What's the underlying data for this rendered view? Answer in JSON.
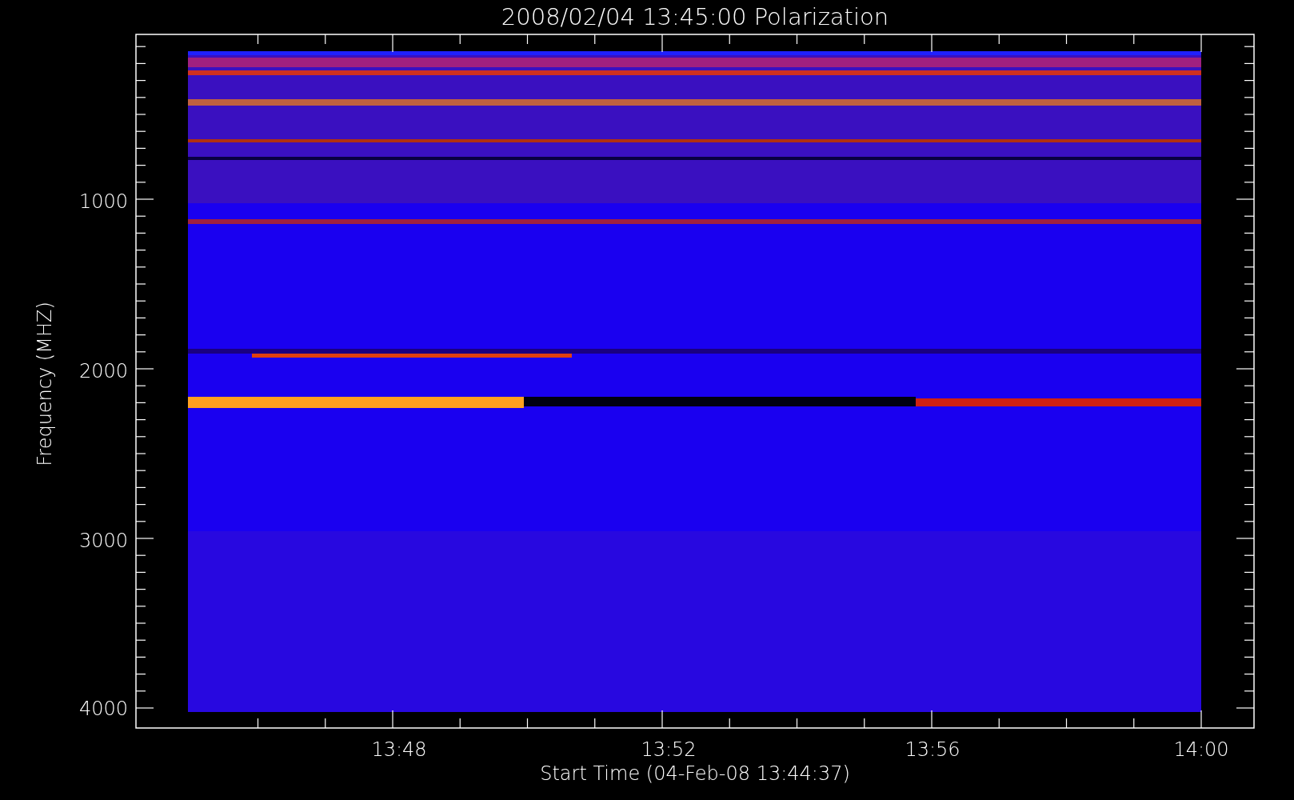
{
  "title": "2008/02/04 13:45:00 Polarization",
  "y_axis": {
    "label": "Frequency (MHZ)",
    "ticks": [
      "1000",
      "2000",
      "3000",
      "4000"
    ]
  },
  "x_axis": {
    "label": "Start Time (04-Feb-08 13:44:37)",
    "ticks": [
      "13:48",
      "13:52",
      "13:56",
      "14:00"
    ]
  }
}
